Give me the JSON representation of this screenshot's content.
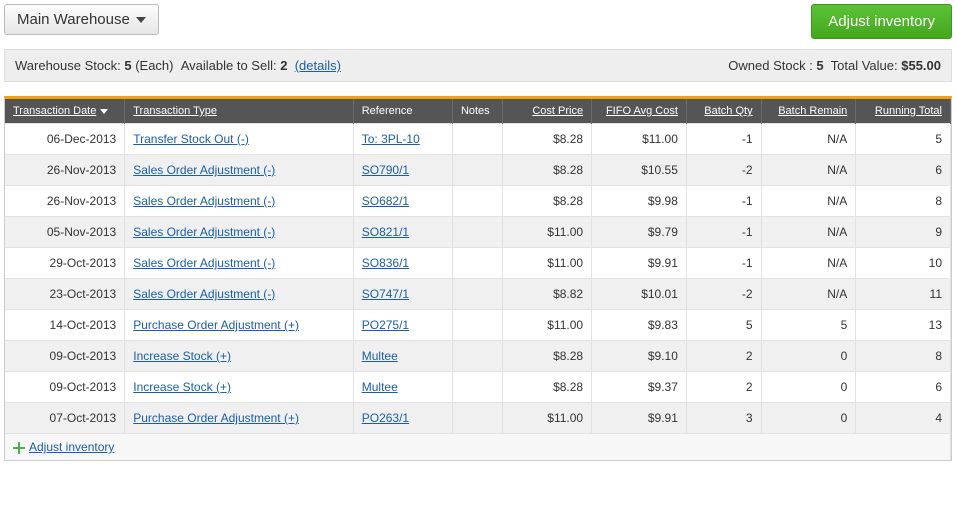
{
  "top": {
    "warehouse_label": "Main Warehouse",
    "adjust_label": "Adjust inventory"
  },
  "summary": {
    "stock_label": "Warehouse Stock: ",
    "stock_value": "5",
    "stock_unit": " (Each)  Available to Sell: ",
    "avail_value": "2",
    "details_label": "(details)",
    "owned_label": "Owned Stock : ",
    "owned_value": "5",
    "total_label": "  Total Value: ",
    "total_value": "$55.00"
  },
  "headers": {
    "date": "Transaction Date",
    "type": "Transaction Type",
    "ref": "Reference",
    "notes": "Notes",
    "cost": "Cost Price",
    "fifo": "FIFO Avg Cost",
    "bq": "Batch Qty",
    "br": "Batch Remain",
    "rt": "Running Total"
  },
  "rows": [
    {
      "date": "06-Dec-2013",
      "type": "Transfer Stock Out (-)",
      "ref": "To: 3PL-10",
      "notes": "",
      "cost": "$8.28",
      "fifo": "$11.00",
      "bq": "-1",
      "br": "N/A",
      "rt": "5"
    },
    {
      "date": "26-Nov-2013",
      "type": "Sales Order Adjustment (-)",
      "ref": "SO790/1",
      "notes": "",
      "cost": "$8.28",
      "fifo": "$10.55",
      "bq": "-2",
      "br": "N/A",
      "rt": "6"
    },
    {
      "date": "26-Nov-2013",
      "type": "Sales Order Adjustment (-)",
      "ref": "SO682/1",
      "notes": "",
      "cost": "$8.28",
      "fifo": "$9.98",
      "bq": "-1",
      "br": "N/A",
      "rt": "8"
    },
    {
      "date": "05-Nov-2013",
      "type": "Sales Order Adjustment (-)",
      "ref": "SO821/1",
      "notes": "",
      "cost": "$11.00",
      "fifo": "$9.79",
      "bq": "-1",
      "br": "N/A",
      "rt": "9"
    },
    {
      "date": "29-Oct-2013",
      "type": "Sales Order Adjustment (-)",
      "ref": "SO836/1",
      "notes": "",
      "cost": "$11.00",
      "fifo": "$9.91",
      "bq": "-1",
      "br": "N/A",
      "rt": "10"
    },
    {
      "date": "23-Oct-2013",
      "type": "Sales Order Adjustment (-)",
      "ref": "SO747/1",
      "notes": "",
      "cost": "$8.82",
      "fifo": "$10.01",
      "bq": "-2",
      "br": "N/A",
      "rt": "11"
    },
    {
      "date": "14-Oct-2013",
      "type": "Purchase Order Adjustment (+)",
      "ref": "PO275/1",
      "notes": "",
      "cost": "$11.00",
      "fifo": "$9.83",
      "bq": "5",
      "br": "5",
      "rt": "13"
    },
    {
      "date": "09-Oct-2013",
      "type": "Increase Stock (+)",
      "ref": "Multee",
      "notes": "",
      "cost": "$8.28",
      "fifo": "$9.10",
      "bq": "2",
      "br": "0",
      "rt": "8"
    },
    {
      "date": "09-Oct-2013",
      "type": "Increase Stock (+)",
      "ref": "Multee",
      "notes": "",
      "cost": "$8.28",
      "fifo": "$9.37",
      "bq": "2",
      "br": "0",
      "rt": "6"
    },
    {
      "date": "07-Oct-2013",
      "type": "Purchase Order Adjustment (+)",
      "ref": "PO263/1",
      "notes": "",
      "cost": "$11.00",
      "fifo": "$9.91",
      "bq": "3",
      "br": "0",
      "rt": "4"
    }
  ],
  "footer": {
    "adjust_link": "Adjust inventory"
  }
}
